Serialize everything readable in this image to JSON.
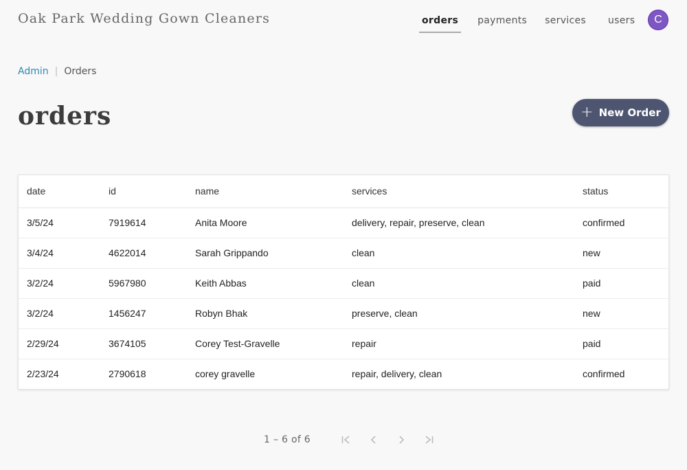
{
  "header": {
    "brand": "Oak Park Wedding Gown Cleaners",
    "nav": [
      {
        "label": "orders",
        "active": true
      },
      {
        "label": "payments",
        "active": false
      },
      {
        "label": "services",
        "active": false
      },
      {
        "label": "users",
        "active": false
      }
    ],
    "avatar_initial": "C",
    "avatar_color": "#7e57c2"
  },
  "breadcrumb": {
    "link": "Admin",
    "separator": "|",
    "current": "Orders"
  },
  "page_title": "orders",
  "new_button": {
    "icon": "plus-icon",
    "label": "New Order",
    "color": "#4e5571"
  },
  "table": {
    "columns": [
      "date",
      "id",
      "name",
      "services",
      "status"
    ],
    "rows": [
      [
        "3/5/24",
        "7919614",
        "Anita Moore",
        "delivery, repair, preserve, clean",
        "confirmed"
      ],
      [
        "3/4/24",
        "4622014",
        "Sarah Grippando",
        "clean",
        "new"
      ],
      [
        "3/2/24",
        "5967980",
        "Keith Abbas",
        "clean",
        "paid"
      ],
      [
        "3/2/24",
        "1456247",
        "Robyn Bhak",
        "preserve, clean",
        "new"
      ],
      [
        "2/29/24",
        "3674105",
        "Corey Test-Gravelle",
        "repair",
        "paid"
      ],
      [
        "2/23/24",
        "2790618",
        "corey gravelle",
        "repair, delivery, clean",
        "confirmed"
      ]
    ]
  },
  "pagination": {
    "range": "1 – 6 of 6",
    "icons": [
      "first-page-icon",
      "previous-page-icon",
      "next-page-icon",
      "last-page-icon"
    ]
  }
}
